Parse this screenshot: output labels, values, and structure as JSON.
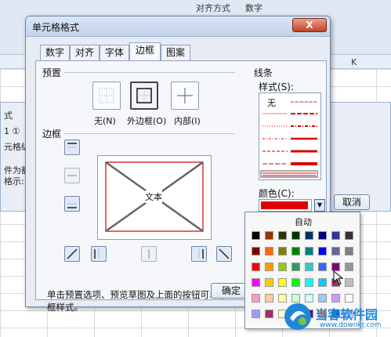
{
  "ribbon": {
    "group_align": "对齐方式",
    "group_number": "数字"
  },
  "sheet": {
    "col_k": "K"
  },
  "back_dialog": {
    "t1": "式",
    "t2": "1 ①",
    "t3": "元格纵",
    "t4": "件为额",
    "t5": "格示:",
    "cancel": "取消"
  },
  "dialog": {
    "title": "单元格格式",
    "close": "X",
    "tabs": [
      "数字",
      "对齐",
      "字体",
      "边框",
      "图案"
    ],
    "active_tab": "边框",
    "presets_label": "预置",
    "presets": [
      {
        "label": "无(N)",
        "icon": "no-border-icon"
      },
      {
        "label": "外边框(O)",
        "icon": "outline-border-icon"
      },
      {
        "label": "内部(I)",
        "icon": "inside-border-icon"
      }
    ],
    "border_label": "边框",
    "preview_text": "文本",
    "hint": "单击预置选项、预览草图及上面的按钮可以添加边框样式。",
    "line_label": "线条",
    "style_label": "样式(S):",
    "style_none": "无",
    "color_label": "颜色(C):",
    "color_value": "#E00000",
    "ok": "确定"
  },
  "palette": {
    "auto": "自动",
    "colors": [
      [
        "#000000",
        "#993300",
        "#333300",
        "#003300",
        "#003366",
        "#000080",
        "#333399",
        "#333333"
      ],
      [
        "#800000",
        "#FF6600",
        "#808000",
        "#008000",
        "#008080",
        "#0000FF",
        "#666699",
        "#808080"
      ],
      [
        "#FF0000",
        "#FF9900",
        "#99CC00",
        "#339966",
        "#33CCCC",
        "#3366FF",
        "#800080",
        "#969696"
      ],
      [
        "#FF00FF",
        "#FFCC00",
        "#FFFF00",
        "#00FF00",
        "#00FFFF",
        "#00CCFF",
        "#993366",
        "#C0C0C0"
      ],
      [
        "#FF99CC",
        "#FFCC99",
        "#FFFF99",
        "#CCFFCC",
        "#CCFFFF",
        "#99CCFF",
        "#CC99FF",
        "#FFFFFF"
      ],
      [
        "#9999FF",
        "#993366",
        "#FFFFCC",
        "#CCFFFF",
        "#660066",
        "#FF8080",
        "#0066CC",
        "#CCCCFF"
      ]
    ]
  },
  "watermark": {
    "name": "当客软件园",
    "url": "www.downkr.com"
  }
}
